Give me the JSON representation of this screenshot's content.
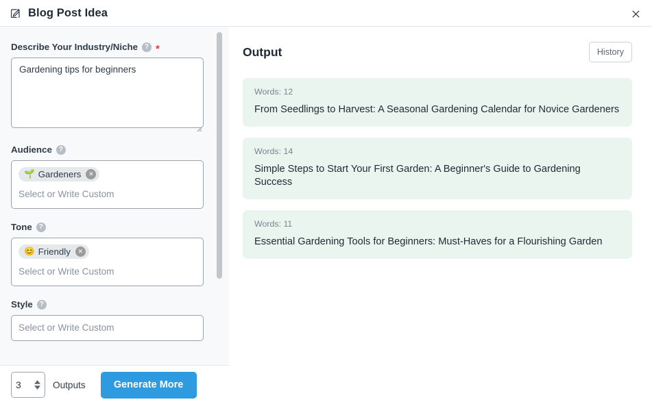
{
  "window": {
    "title": "Blog Post Idea",
    "title_icon": "edit-square-icon",
    "close_icon": "close-icon"
  },
  "form": {
    "industry": {
      "label": "Describe Your Industry/Niche",
      "help_icon": "?",
      "required_marker": "*",
      "value": "Gardening tips for beginners"
    },
    "audience": {
      "label": "Audience",
      "help_icon": "?",
      "placeholder": "Select or Write Custom",
      "tags": [
        {
          "emoji": "🌱",
          "label": "Gardeners",
          "remove_icon": "✕"
        }
      ]
    },
    "tone": {
      "label": "Tone",
      "help_icon": "?",
      "placeholder": "Select or Write Custom",
      "tags": [
        {
          "emoji": "😊",
          "label": "Friendly",
          "remove_icon": "✕"
        }
      ]
    },
    "style": {
      "label": "Style",
      "help_icon": "?",
      "placeholder": "Select or Write Custom",
      "tags": []
    }
  },
  "footer": {
    "outputs_count": "3",
    "outputs_label": "Outputs",
    "generate_label": "Generate More",
    "stepper_up_icon": "chevron-up-icon",
    "stepper_down_icon": "chevron-down-icon",
    "accent_color": "#2e9ae0"
  },
  "output": {
    "title": "Output",
    "history_label": "History",
    "card_bg_color": "#eaf5f0",
    "cards": [
      {
        "words_label": "Words: 12",
        "text": "From Seedlings to Harvest: A Seasonal Gardening Calendar for Novice Gardeners"
      },
      {
        "words_label": "Words: 14",
        "text": "Simple Steps to Start Your First Garden: A Beginner's Guide to Gardening Success"
      },
      {
        "words_label": "Words: 11",
        "text": "Essential Gardening Tools for Beginners: Must-Haves for a Flourishing Garden"
      }
    ]
  }
}
